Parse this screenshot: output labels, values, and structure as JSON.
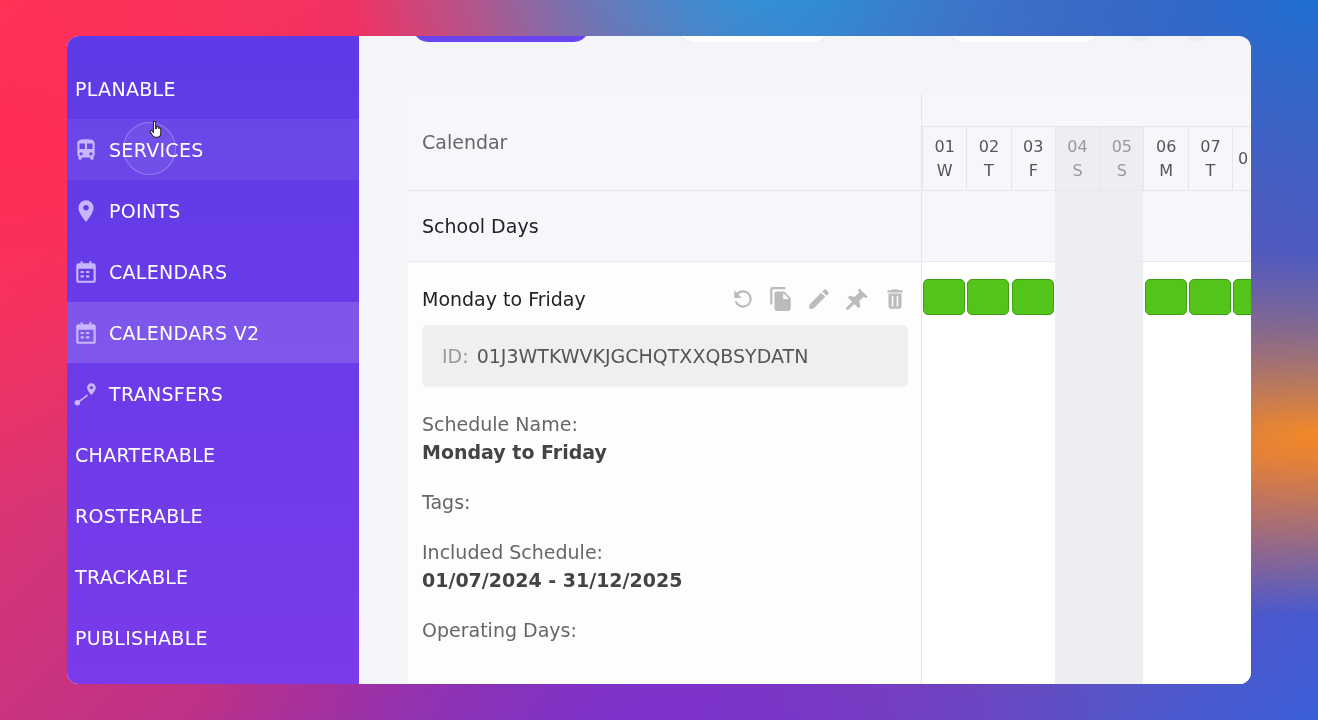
{
  "sidebar": {
    "items": [
      {
        "kind": "section",
        "label": "PLANABLE",
        "selected": false
      },
      {
        "kind": "nav",
        "label": "SERVICES",
        "selected": false,
        "hovered": true
      },
      {
        "kind": "nav",
        "label": "POINTS",
        "selected": false,
        "hovered": false
      },
      {
        "kind": "nav",
        "label": "CALENDARS",
        "selected": false,
        "hovered": false
      },
      {
        "kind": "nav",
        "label": "CALENDARS V2",
        "selected": true,
        "hovered": false
      },
      {
        "kind": "nav",
        "label": "TRANSFERS",
        "selected": false,
        "hovered": false
      },
      {
        "kind": "section",
        "label": "CHARTERABLE",
        "selected": false
      },
      {
        "kind": "section",
        "label": "ROSTERABLE",
        "selected": false
      },
      {
        "kind": "section",
        "label": "TRACKABLE",
        "selected": false
      },
      {
        "kind": "section",
        "label": "PUBLISHABLE",
        "selected": false
      }
    ]
  },
  "calendar": {
    "heading": "Calendar",
    "days": [
      {
        "num": "01",
        "letter": "W",
        "weekend": false
      },
      {
        "num": "02",
        "letter": "T",
        "weekend": false
      },
      {
        "num": "03",
        "letter": "F",
        "weekend": false
      },
      {
        "num": "04",
        "letter": "S",
        "weekend": true
      },
      {
        "num": "05",
        "letter": "S",
        "weekend": true
      },
      {
        "num": "06",
        "letter": "M",
        "weekend": false
      },
      {
        "num": "07",
        "letter": "T",
        "weekend": false
      },
      {
        "num": "0"
      }
    ],
    "rows": [
      {
        "kind": "group",
        "title": "School Days"
      },
      {
        "kind": "schedule",
        "title": "Monday to Friday",
        "id_label": "ID:",
        "id_value": "01J3WTKWVKJGCHQTXXQBSYDATN",
        "fields": [
          {
            "label": "Schedule Name:",
            "value": "Monday to Friday"
          },
          {
            "label": "Tags:"
          },
          {
            "label": "Included Schedule:",
            "value": "01/07/2024 - 31/12/2025"
          },
          {
            "label": "Operating Days:"
          }
        ],
        "active": [
          true,
          true,
          true,
          false,
          false,
          true,
          true,
          true
        ]
      }
    ]
  }
}
